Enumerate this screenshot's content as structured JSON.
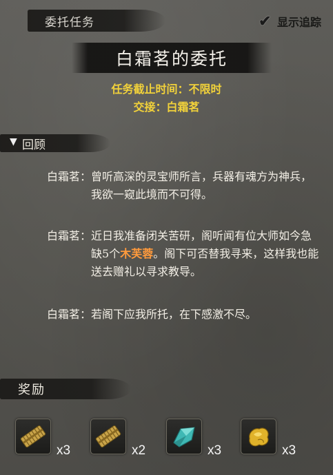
{
  "header": {
    "tab_label": "委托任务",
    "track_label": "显示追踪"
  },
  "quest": {
    "title": "白霜茗的委托",
    "deadline": "任务截止时间：不限时",
    "giver": "交接：白霜茗"
  },
  "review": {
    "label": "回顾",
    "dialogues": [
      {
        "speaker": "白霜茗：",
        "text": "曾听高深的灵宝师所言，兵器有魂方为神兵，我欲一窥此境而不可得。"
      },
      {
        "speaker": "白霜茗：",
        "text_before": "近日我准备闭关苦研，阁听闻有位大师如今急缺5个",
        "highlight": "木芙蓉",
        "text_after": "。阁下可否替我寻来，这样我也能送去赠礼以寻求教导。"
      },
      {
        "speaker": "白霜茗：",
        "text": "若阁下应我所托，在下感激不尽。"
      }
    ]
  },
  "rewards": {
    "label": "奖励",
    "items": [
      {
        "icon": "bamboo-scroll-icon",
        "qty": "x3"
      },
      {
        "icon": "bamboo-scroll-icon",
        "qty": "x2"
      },
      {
        "icon": "cyan-crystal-icon",
        "qty": "x3"
      },
      {
        "icon": "gold-ore-icon",
        "qty": "x3"
      }
    ]
  },
  "colors": {
    "accent_yellow": "#f2d23a",
    "highlight_orange": "#ff9a3c",
    "panel_bg": "#5a5955"
  }
}
